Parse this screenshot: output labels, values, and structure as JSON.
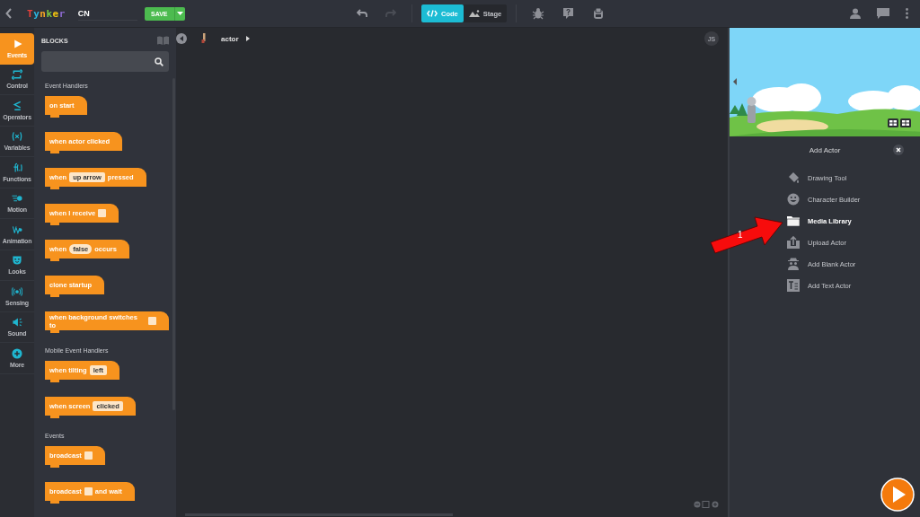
{
  "topbar": {
    "logo": "Tynker",
    "project_name": "CN",
    "save_button": "SAVE",
    "redo_disabled": true,
    "view_tabs": [
      {
        "label": "Code",
        "selected": true
      },
      {
        "label": "Stage",
        "selected": false
      }
    ]
  },
  "categories": [
    {
      "label": "Events",
      "kind": "events",
      "selected": true
    },
    {
      "label": "Control",
      "kind": "control",
      "selected": false
    },
    {
      "label": "Operators",
      "kind": "operators",
      "selected": false
    },
    {
      "label": "Variables",
      "kind": "variables",
      "selected": false
    },
    {
      "label": "Functions",
      "kind": "functions",
      "selected": false
    },
    {
      "label": "Motion",
      "kind": "motion",
      "selected": false
    },
    {
      "label": "Animation",
      "kind": "animation",
      "selected": false
    },
    {
      "label": "Looks",
      "kind": "looks",
      "selected": false
    },
    {
      "label": "Sensing",
      "kind": "sensing",
      "selected": false
    },
    {
      "label": "Sound",
      "kind": "sound",
      "selected": false
    },
    {
      "label": "More",
      "kind": "more",
      "selected": false
    }
  ],
  "palette": {
    "title": "BLOCKS",
    "sections": [
      {
        "heading": "Event Handlers",
        "blocks": [
          {
            "parts": [
              {
                "kind": "text",
                "text": "on start"
              }
            ]
          },
          {
            "parts": [
              {
                "kind": "text",
                "text": "when actor clicked"
              }
            ]
          },
          {
            "parts": [
              {
                "kind": "text",
                "text": "when"
              },
              {
                "kind": "field",
                "text": "up arrow"
              },
              {
                "kind": "text",
                "text": "pressed"
              }
            ]
          },
          {
            "parts": [
              {
                "kind": "text",
                "text": "when I receive"
              },
              {
                "kind": "slot"
              }
            ]
          },
          {
            "parts": [
              {
                "kind": "text",
                "text": "when"
              },
              {
                "kind": "bool",
                "text": "false"
              },
              {
                "kind": "text",
                "text": "occurs"
              }
            ]
          },
          {
            "parts": [
              {
                "kind": "text",
                "text": "clone startup"
              }
            ]
          },
          {
            "parts": [
              {
                "kind": "text",
                "text": "when background switches to"
              },
              {
                "kind": "slot"
              }
            ]
          }
        ]
      },
      {
        "heading": "Mobile Event Handlers",
        "blocks": [
          {
            "parts": [
              {
                "kind": "text",
                "text": "when tilting"
              },
              {
                "kind": "field",
                "text": "left"
              }
            ]
          },
          {
            "parts": [
              {
                "kind": "text",
                "text": "when screen"
              },
              {
                "kind": "field",
                "text": "clicked"
              }
            ]
          }
        ]
      },
      {
        "heading": "Events",
        "blocks": [
          {
            "parts": [
              {
                "kind": "text",
                "text": "broadcast"
              },
              {
                "kind": "slot"
              }
            ]
          },
          {
            "parts": [
              {
                "kind": "text",
                "text": "broadcast"
              },
              {
                "kind": "slot"
              },
              {
                "kind": "text",
                "text": "and wait"
              }
            ]
          }
        ]
      }
    ]
  },
  "canvas": {
    "breadcrumb": "actor",
    "badge": "JS"
  },
  "add_actor": {
    "title": "Add Actor",
    "items": [
      {
        "label": "Drawing Tool",
        "kind": "drawing",
        "selected": false
      },
      {
        "label": "Character Builder",
        "kind": "character",
        "selected": false
      },
      {
        "label": "Media Library",
        "kind": "media",
        "selected": true
      },
      {
        "label": "Upload Actor",
        "kind": "upload",
        "selected": false
      },
      {
        "label": "Add Blank Actor",
        "kind": "blank",
        "selected": false
      },
      {
        "label": "Add Text Actor",
        "kind": "text",
        "selected": false
      }
    ]
  },
  "annotation": {
    "label": "1"
  }
}
